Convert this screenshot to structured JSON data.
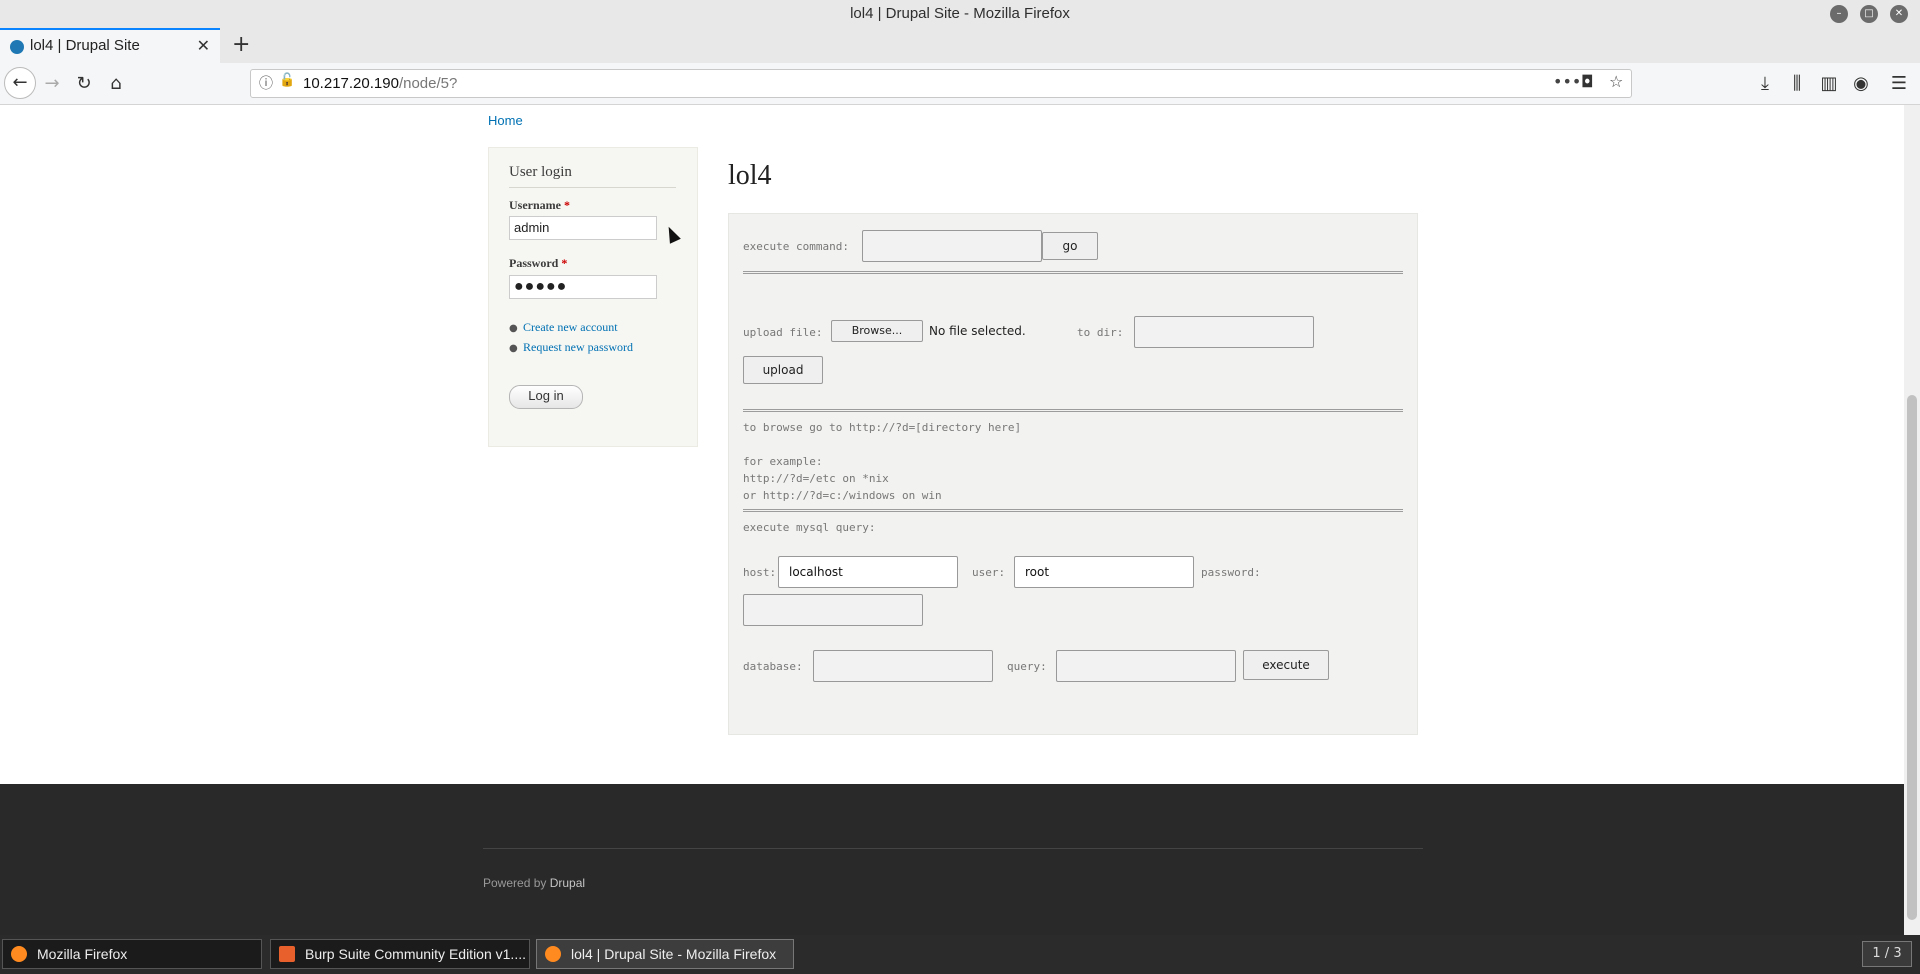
{
  "window": {
    "title": "lol4 | Drupal Site - Mozilla Firefox"
  },
  "browser": {
    "tab_title": "lol4 | Drupal Site",
    "tab_close": "✕",
    "new_tab": "+",
    "url_host": "10.217.20.190",
    "url_path": "/node/5?"
  },
  "breadcrumb": {
    "home": "Home"
  },
  "login": {
    "heading": "User login",
    "username_label": "Username",
    "password_label": "Password",
    "required_mark": "*",
    "username_value": "admin",
    "password_value": "●●●●●",
    "create_account": "Create new account",
    "request_password": "Request new password",
    "login_button": "Log in"
  },
  "main": {
    "title": "lol4",
    "execute_command_label": "execute command:",
    "go_button": "go",
    "upload_file_label": "upload file:",
    "browse_button": "Browse...",
    "no_file": "No file selected.",
    "to_dir_label": "to dir:",
    "upload_button": "upload",
    "browse_hint": "to browse go to http://?d=[directory here]",
    "example_label": "for example:",
    "example_nix": "http://?d=/etc on *nix",
    "example_win": "or http://?d=c:/windows on win",
    "mysql_label": "execute mysql query:",
    "host_label": "host:",
    "host_value": "localhost",
    "user_label": "user:",
    "user_value": "root",
    "password_label": "password:",
    "database_label": "database:",
    "query_label": "query:",
    "execute_button": "execute"
  },
  "footer": {
    "powered_by": "Powered by",
    "drupal": "Drupal"
  },
  "taskbar": {
    "items": [
      {
        "label": "Mozilla Firefox"
      },
      {
        "label": "Burp Suite Community Edition v1...."
      },
      {
        "label": "lol4 | Drupal Site - Mozilla Firefox"
      }
    ],
    "pager": "1 / 3"
  },
  "colors": {
    "link": "#0071b3",
    "footer_bg": "#292929",
    "tab_accent": "#0a84ff"
  }
}
